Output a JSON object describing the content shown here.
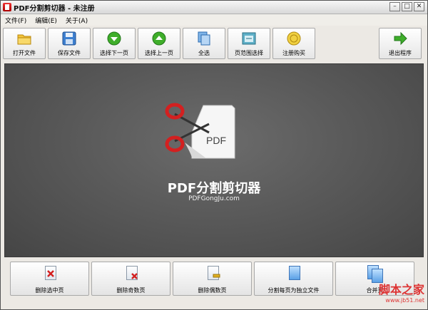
{
  "window": {
    "title": "PDF分割剪切器 - 未注册"
  },
  "menu": [
    "文件(F)",
    "编辑(E)",
    "关于(A)"
  ],
  "toolbar": {
    "open": "打开文件",
    "save": "保存文件",
    "next": "选择下一页",
    "prev": "选择上一页",
    "all": "全选",
    "range": "页范围选择",
    "register": "注册购买",
    "exit": "退出程序"
  },
  "canvas": {
    "logo_doc_text": "PDF",
    "brand_name": "PDF分割剪切器",
    "brand_url": "PDFGongJu.com"
  },
  "actions": {
    "delete_selected": "删除选中页",
    "delete_odd": "删除奇数页",
    "delete_even": "删除偶数页",
    "split_each": "分割每页为独立文件",
    "merge_pages": "合并页"
  },
  "watermark": {
    "main": "脚本之家",
    "url": "www.jb51.net"
  },
  "colors": {
    "accent_red": "#d32020",
    "canvas_bg": "#5a5a5a",
    "button_green": "#3fae2a"
  }
}
